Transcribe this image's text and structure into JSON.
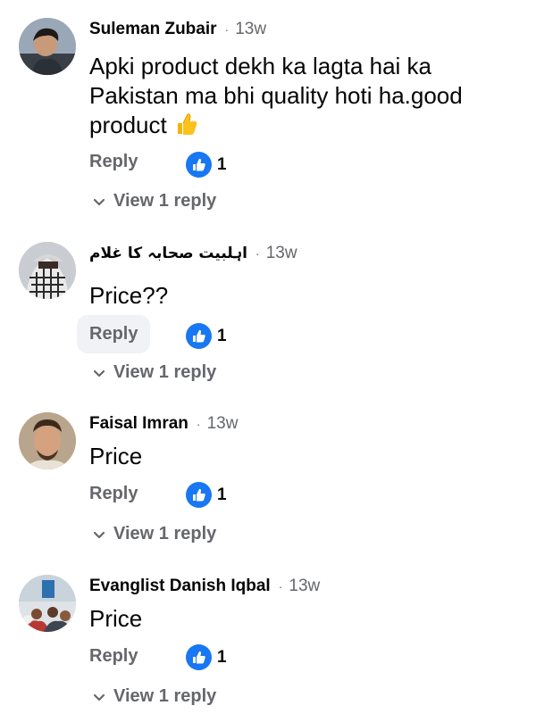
{
  "comments": [
    {
      "author": "Suleman Zubair",
      "time": "13w",
      "text_lines": [
        "Apki product dekh ka lagta hai ka",
        "Pakistan ma bhi quality hoti ha.good",
        "product"
      ],
      "emoji": "thumbs-up-emoji",
      "reply_label": "Reply",
      "likes": "1",
      "view_replies": "View 1 reply"
    },
    {
      "author": "اہلبیت صحابہ کا غلام",
      "time": "13w",
      "text_lines": [
        "Price??"
      ],
      "reply_label": "Reply",
      "likes": "1",
      "view_replies": "View 1 reply"
    },
    {
      "author": "Faisal Imran",
      "time": "13w",
      "text_lines": [
        "Price"
      ],
      "reply_label": "Reply",
      "likes": "1",
      "view_replies": "View 1 reply"
    },
    {
      "author": "Evanglist Danish Iqbal",
      "time": "13w",
      "text_lines": [
        "Price"
      ],
      "reply_label": "Reply",
      "likes": "1",
      "view_replies": "View 1 reply"
    }
  ],
  "separator": "·",
  "colors": {
    "like_blue": "#1877f2",
    "secondary_text": "#65676b",
    "primary_text": "#050505"
  }
}
